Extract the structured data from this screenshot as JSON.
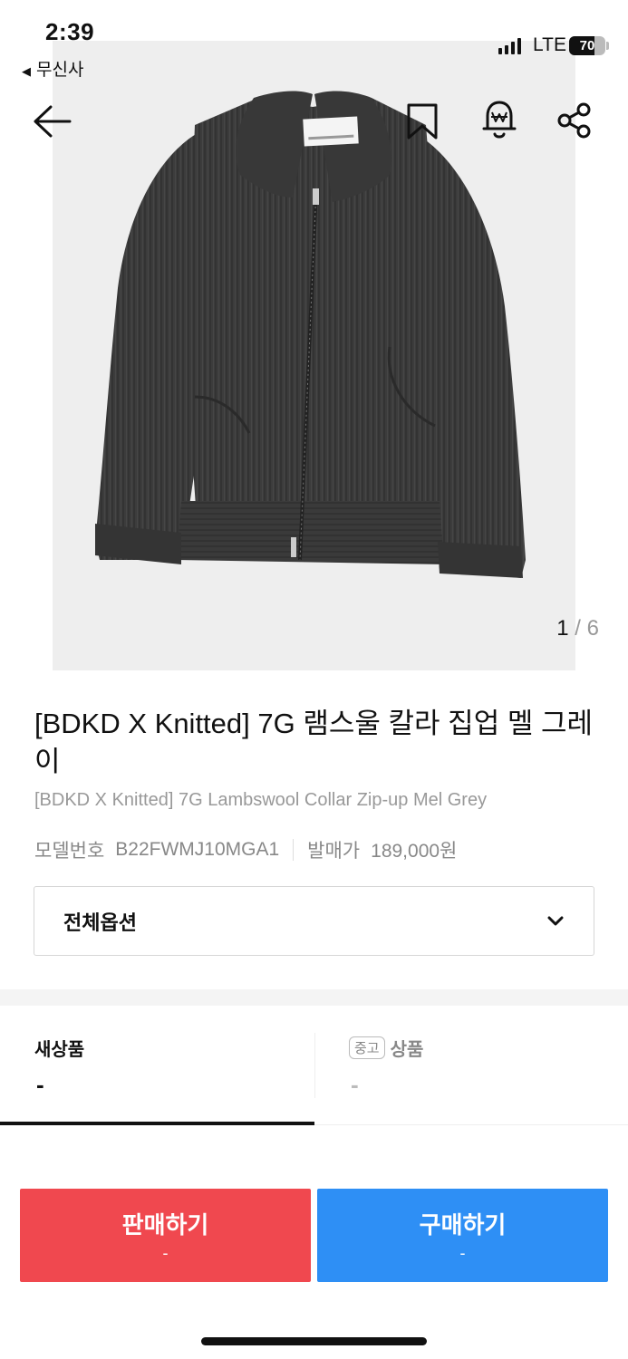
{
  "status_bar": {
    "time": "2:39",
    "back_app": "무신사",
    "network": "LTE",
    "battery": "70",
    "battery_level": 0.7
  },
  "hero": {
    "image_index": "1",
    "image_separator": "/",
    "image_total": "6",
    "icons": [
      "back-arrow-icon",
      "bookmark-icon",
      "bell-icon",
      "share-icon"
    ]
  },
  "product": {
    "title": "[BDKD X Knitted] 7G 램스울 칼라 집업 멜 그레이",
    "subtitle": "[BDKD X Knitted] 7G Lambswool Collar Zip-up Mel Grey",
    "model_label": "모델번호",
    "model_value": "B22FWMJ10MGA1",
    "price_label": "발매가",
    "price_value": "189,000원"
  },
  "options": {
    "label": "전체옵션"
  },
  "tabs": {
    "new": {
      "label": "새상품",
      "value": "-"
    },
    "used": {
      "badge": "중고",
      "label": "상품",
      "value": "-"
    }
  },
  "actions": {
    "sell": {
      "label": "판매하기",
      "price": "-"
    },
    "buy": {
      "label": "구매하기",
      "price": "-"
    }
  },
  "colors": {
    "sell": "#f0484f",
    "buy": "#2e8ff5",
    "text": "#111111",
    "muted": "#999999"
  }
}
